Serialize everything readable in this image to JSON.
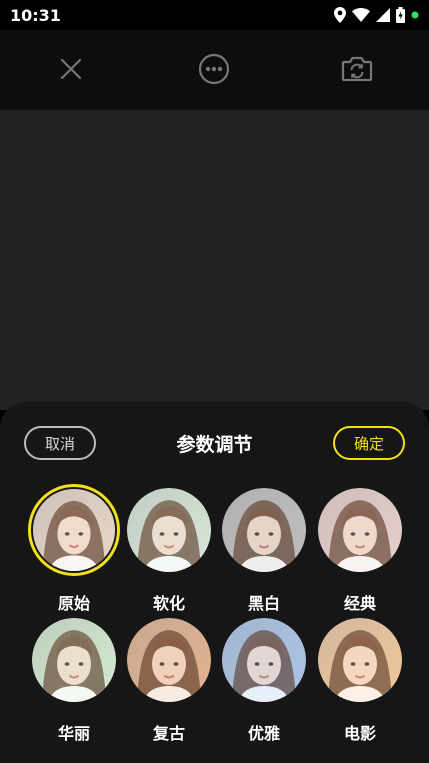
{
  "status_bar": {
    "time": "10:31",
    "icons": [
      "location-icon",
      "wifi-icon",
      "signal-icon",
      "battery-charging-icon",
      "green-dot-icon"
    ]
  },
  "toolbar": {
    "close_icon": "close-icon",
    "more_icon": "more-icon",
    "switch_camera_icon": "camera-switch-icon"
  },
  "panel": {
    "title": "参数调节",
    "cancel_label": "取消",
    "confirm_label": "确定",
    "accent_color": "#f2e01a"
  },
  "filters": [
    {
      "label": "原始",
      "tint": "#e9d6c8",
      "selected": true
    },
    {
      "label": "软化",
      "tint": "#d7e7d8",
      "selected": false
    },
    {
      "label": "黑白",
      "tint": "#bdbdbd",
      "selected": false
    },
    {
      "label": "经典",
      "tint": "#e8d0cc",
      "selected": false
    },
    {
      "label": "华丽",
      "tint": "#d2ead0",
      "selected": false
    },
    {
      "label": "复古",
      "tint": "#e2b08a",
      "selected": false
    },
    {
      "label": "优雅",
      "tint": "#a9c2e8",
      "selected": false
    },
    {
      "label": "电影",
      "tint": "#f0c79a",
      "selected": false
    }
  ]
}
